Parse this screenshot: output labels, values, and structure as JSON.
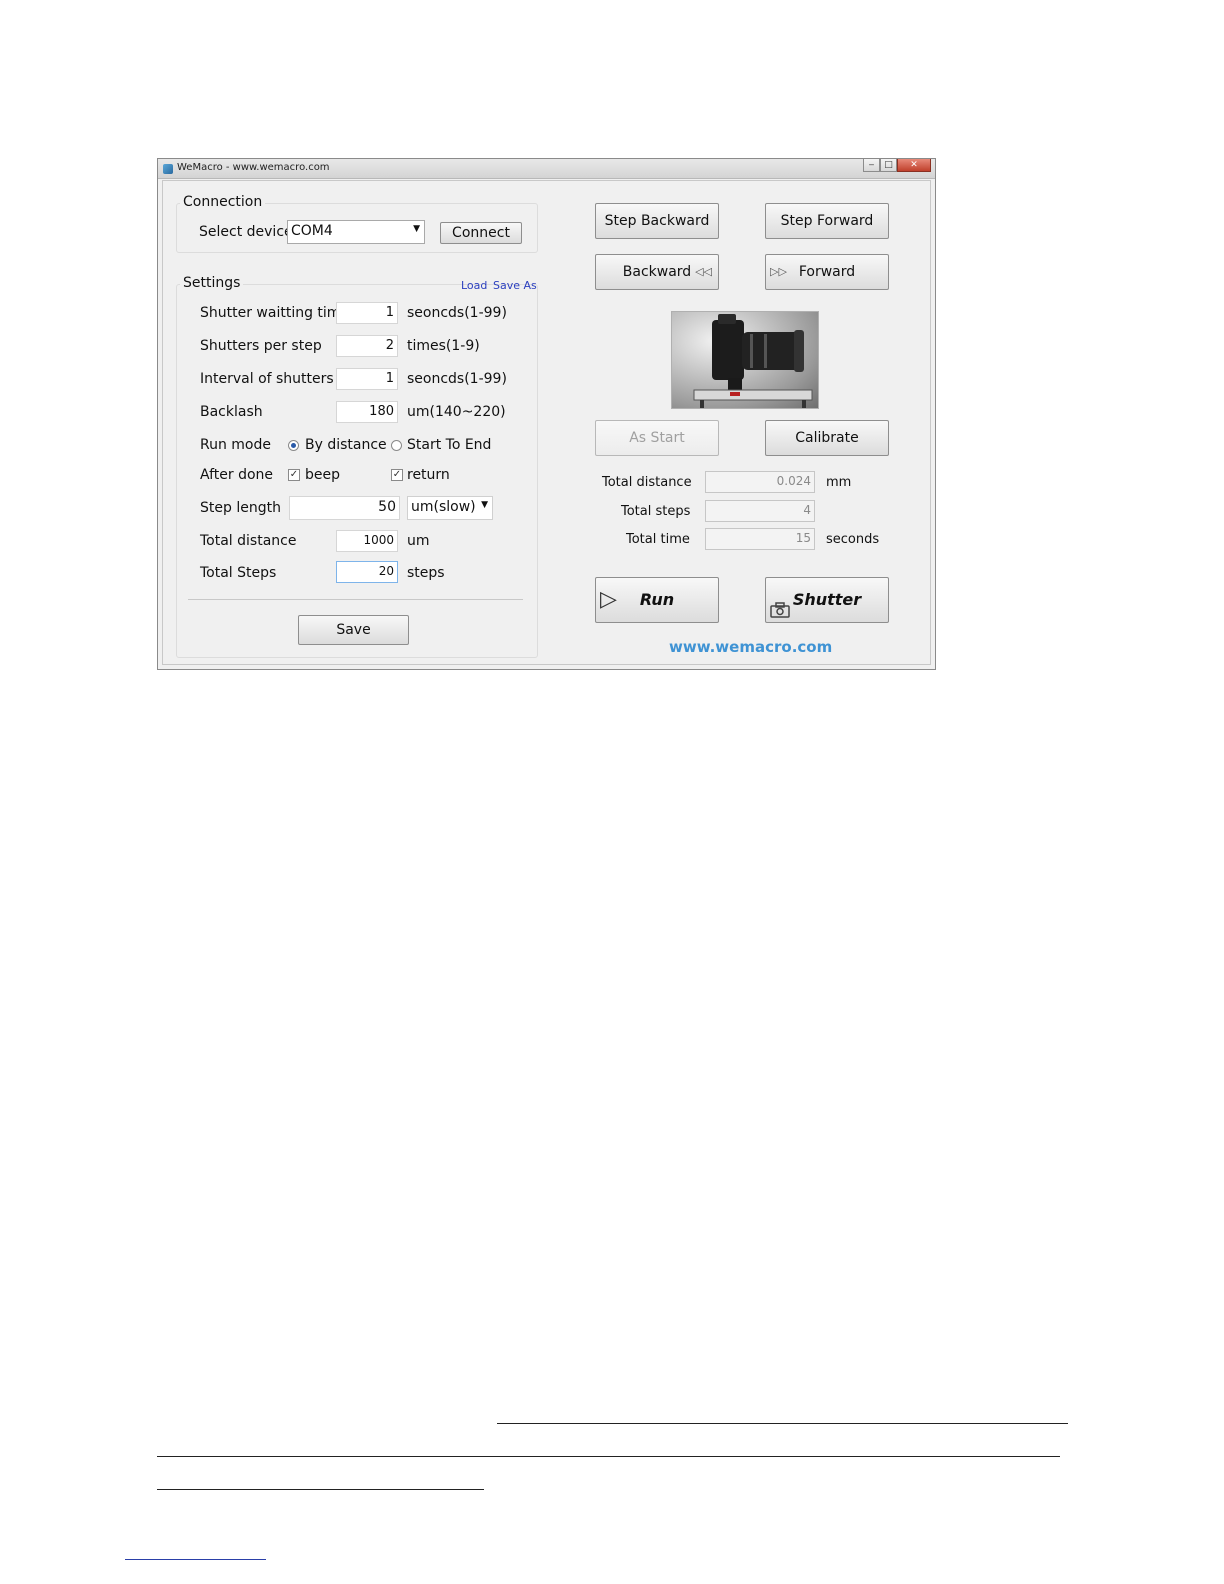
{
  "window": {
    "title": "WeMacro - www.wemacro.com"
  },
  "connection": {
    "group_title": "Connection",
    "select_label": "Select device",
    "device_value": "COM4",
    "connect_label": "Connect"
  },
  "settings": {
    "group_title": "Settings",
    "load_link": "Load",
    "save_as_link": "Save As",
    "rows": {
      "shutter_wait": {
        "label": "Shutter waitting time",
        "value": "1",
        "unit": "seoncds(1-99)"
      },
      "shutters_per_step": {
        "label": "Shutters per step",
        "value": "2",
        "unit": "times(1-9)"
      },
      "interval": {
        "label": "Interval of shutters",
        "value": "1",
        "unit": "seoncds(1-99)"
      },
      "backlash": {
        "label": "Backlash",
        "value": "180",
        "unit": "um(140~220)"
      },
      "total_distance": {
        "label": "Total distance",
        "value": "1000",
        "unit": "um"
      },
      "total_steps": {
        "label": "Total Steps",
        "value": "20",
        "unit": "steps"
      }
    },
    "run_mode": {
      "label": "Run mode",
      "option_distance": "By distance",
      "option_start_end": "Start To End",
      "selected": "By distance"
    },
    "after_done": {
      "label": "After done",
      "beep": "beep",
      "return": "return",
      "beep_checked": true,
      "return_checked": true,
      "check_glyph": "✓"
    },
    "step_length": {
      "label": "Step length",
      "value": "50",
      "speed_value": "um(slow)"
    },
    "save_label": "Save"
  },
  "controls": {
    "step_backward": "Step Backward",
    "step_forward": "Step Forward",
    "backward": "Backward",
    "forward": "Forward",
    "as_start": "As Start",
    "calibrate": "Calibrate",
    "run": "Run",
    "shutter": "Shutter"
  },
  "stats": {
    "total_distance": {
      "label": "Total distance",
      "value": "0.024",
      "unit": "mm"
    },
    "total_steps": {
      "label": "Total steps",
      "value": "4"
    },
    "total_time": {
      "label": "Total time",
      "value": "15",
      "unit": "seconds"
    }
  },
  "footer_link": "www.wemacro.com",
  "colors": {
    "link": "#2b3fbf",
    "footer_link": "#3f93d4",
    "window_bg": "#f0f0f0"
  },
  "icons": {
    "backward": "double-left-arrow-icon",
    "forward": "double-right-arrow-icon",
    "run": "play-icon",
    "shutter": "camera-icon",
    "dropdown": "chevron-down-icon"
  }
}
